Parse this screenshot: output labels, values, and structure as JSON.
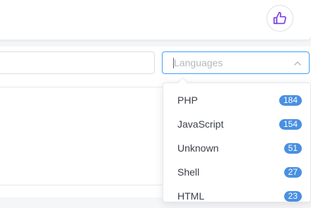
{
  "header": {
    "like_icon": "thumbs-up-icon",
    "accent": "#7b3fe4"
  },
  "filters": {
    "search": {
      "value": "",
      "placeholder": ""
    },
    "languages": {
      "placeholder": "Languages",
      "icon": "chevron-up-icon",
      "focus_color": "#409eff"
    }
  },
  "dropdown": {
    "badge_color": "#4a90e2",
    "options": [
      {
        "label": "PHP",
        "count": "184"
      },
      {
        "label": "JavaScript",
        "count": "154"
      },
      {
        "label": "Unknown",
        "count": "51"
      },
      {
        "label": "Shell",
        "count": "27"
      },
      {
        "label": "HTML",
        "count": "23"
      }
    ]
  }
}
